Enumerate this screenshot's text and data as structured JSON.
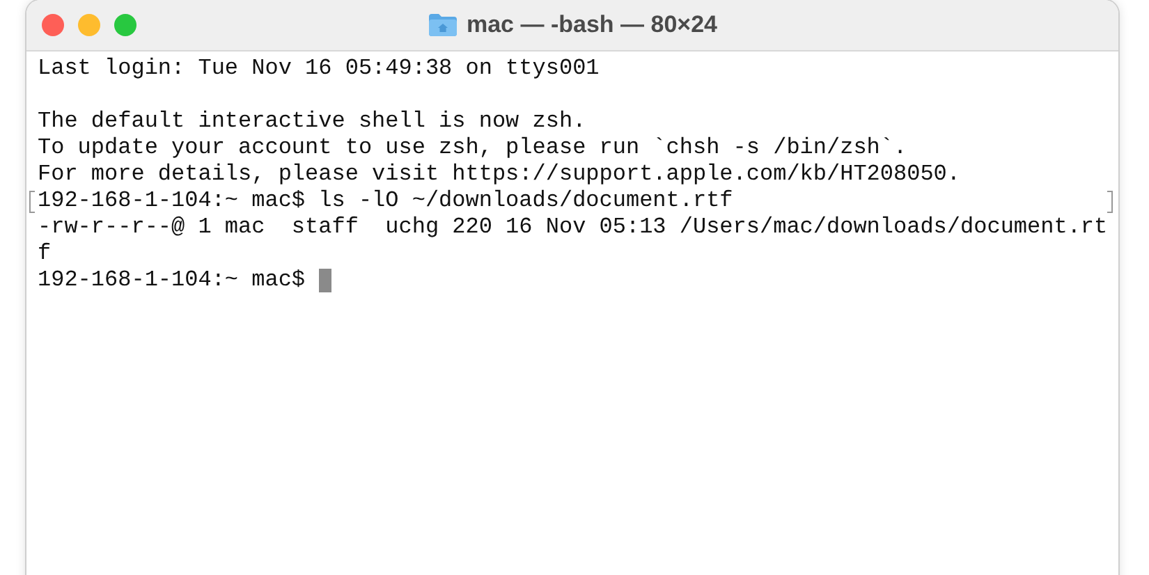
{
  "window": {
    "title": "mac — -bash — 80×24"
  },
  "terminal": {
    "blocks": [
      [
        {
          "text": "Last login: Tue Nov 16 05:49:38 on ttys001"
        }
      ],
      [
        {
          "text": "The default interactive shell is now zsh."
        },
        {
          "text": "To update your account to use zsh, please run `chsh -s /bin/zsh`."
        },
        {
          "text": "For more details, please visit https://support.apple.com/kb/HT208050."
        },
        {
          "text": "192-168-1-104:~ mac$ ls -lO ~/downloads/document.rtf",
          "marked": true
        },
        {
          "text": "-rw-r--r--@ 1 mac  staff  uchg 220 16 Nov 05:13 /Users/mac/downloads/document.rt"
        },
        {
          "text": "f"
        },
        {
          "text": "192-168-1-104:~ mac$ ",
          "cursor": true
        }
      ]
    ]
  }
}
